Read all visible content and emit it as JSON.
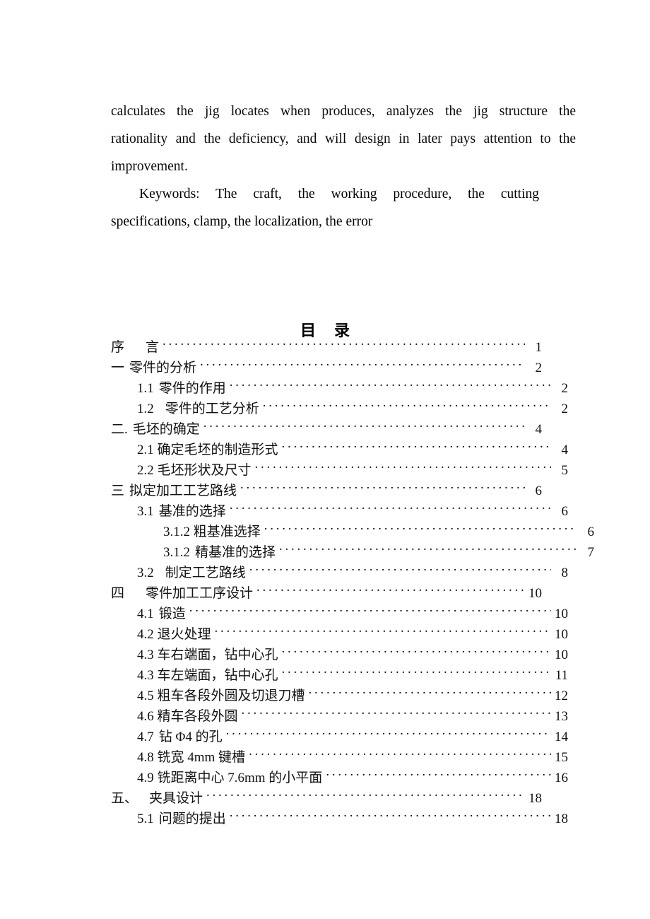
{
  "document": {
    "abstract": {
      "line1": "calculates the jig locates when produces, analyzes the jig structure the",
      "line2": "rationality and the deficiency, and will design in later pays attention to the",
      "line3": "improvement."
    },
    "keywords": {
      "line1": "Keywords: The craft, the working procedure, the cutting",
      "line2": "specifications, clamp, the localization, the error"
    },
    "toc": {
      "title_char_1": "目",
      "title_char_2": "录",
      "entries": [
        {
          "num": "序",
          "sep": "wide",
          "text": "言",
          "page": "1",
          "level": 0
        },
        {
          "num": "一",
          "sep": "sm",
          "text": "零件的分析",
          "page": "2",
          "level": 0
        },
        {
          "num": "1.1",
          "sep": "sm",
          "text": "零件的作用",
          "page": "2",
          "level": 1
        },
        {
          "num": "1.2",
          "sep": "md",
          "text": "零件的工艺分析",
          "page": "2",
          "level": 1
        },
        {
          "num": "二.",
          "sep": "sm",
          "text": "毛坯的确定",
          "page": "4",
          "level": 0
        },
        {
          "num": "2.1",
          "sep": "none",
          "text": "确定毛坯的制造形式",
          "page": "4",
          "level": 1
        },
        {
          "num": "2.2",
          "sep": "none",
          "text": "毛坯形状及尺寸",
          "page": "5",
          "level": 1
        },
        {
          "num": "三",
          "sep": "sm",
          "text": "拟定加工工艺路线",
          "page": "6",
          "level": 0
        },
        {
          "num": "3.1",
          "sep": "sm",
          "text": "基准的选择",
          "page": "6",
          "level": 1
        },
        {
          "num": "3.1.2",
          "sep": "none",
          "text": "粗基准选择",
          "page": "6",
          "level": 2
        },
        {
          "num": "3.1.2",
          "sep": "sm",
          "text": "精基准的选择",
          "page": "7",
          "level": 2
        },
        {
          "num": "3.2",
          "sep": "md",
          "text": "制定工艺路线",
          "page": "8",
          "level": 1
        },
        {
          "num": "四",
          "sep": "lg",
          "text": "零件加工工序设计",
          "page": "10",
          "level": 0
        },
        {
          "num": "4.1",
          "sep": "sm",
          "text": "锻造",
          "page": "10",
          "level": 1
        },
        {
          "num": "4.2",
          "sep": "none",
          "text": "退火处理",
          "page": "10",
          "level": 1
        },
        {
          "num": "4.3",
          "sep": "none",
          "text": "车右端面，钻中心孔",
          "page": "10",
          "level": 1
        },
        {
          "num": "4.3",
          "sep": "none",
          "text": "车左端面，钻中心孔",
          "page": "11",
          "level": 1
        },
        {
          "num": "4.5",
          "sep": "none",
          "text": "粗车各段外圆及切退刀槽",
          "page": "12",
          "level": 1
        },
        {
          "num": "4.6",
          "sep": "none",
          "text": "精车各段外圆",
          "page": "13",
          "level": 1
        },
        {
          "num": "4.7",
          "sep": "sm",
          "text": "钻 Φ4 的孔",
          "page": "14",
          "level": 1
        },
        {
          "num": "4.8",
          "sep": "none",
          "text": "铣宽 4mm 键槽",
          "page": "15",
          "level": 1
        },
        {
          "num": "4.9",
          "sep": "none",
          "text": "铣距离中心 7.6mm 的小平面",
          "page": "16",
          "level": 1
        },
        {
          "num": "五、",
          "sep": "md",
          "text": "夹具设计",
          "page": "18",
          "level": 0
        },
        {
          "num": "5.1",
          "sep": "sm",
          "text": "问题的提出",
          "page": "18",
          "level": 1
        }
      ]
    }
  }
}
